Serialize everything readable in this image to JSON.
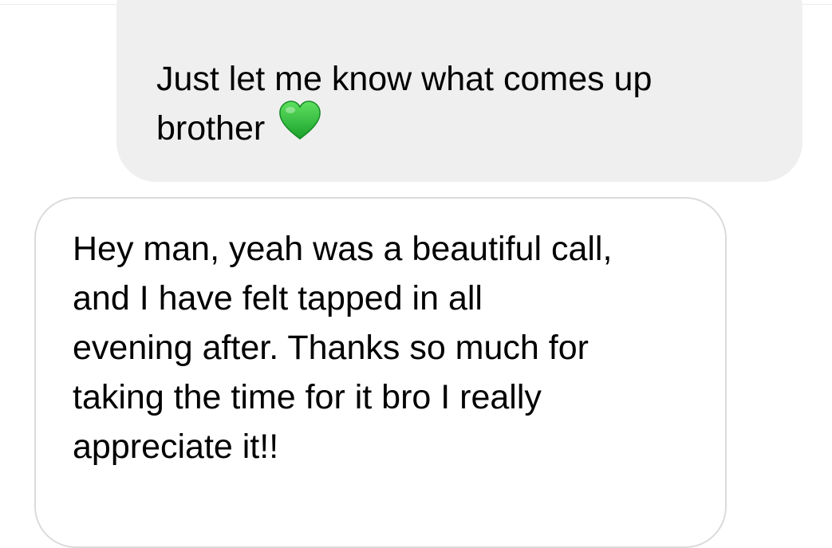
{
  "conversation": {
    "messages": [
      {
        "sender": "self",
        "lines": [
          "Just let me know what comes up",
          "brother"
        ],
        "emoji": "green-heart-icon",
        "bubble_color": "#efefef"
      },
      {
        "sender": "other",
        "lines": [
          "Hey man, yeah was a beautiful call,",
          "and I have felt tapped in all",
          "evening after. Thanks so much for",
          "taking the time for it bro I really",
          "appreciate it!!"
        ],
        "bubble_color": "#ffffff",
        "border_color": "#dbdbdb"
      }
    ]
  },
  "colors": {
    "heart": "#22b53a"
  }
}
